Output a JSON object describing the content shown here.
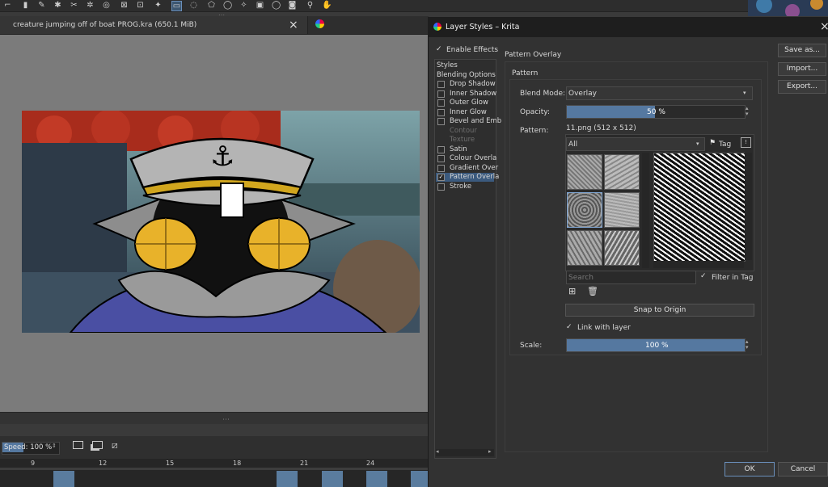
{
  "canvas": {
    "document_tab_title": "creature jumping off of boat PROG.kra (650.1 MiB)"
  },
  "timeline": {
    "speed_label": "Speed:",
    "speed_value": "100 %",
    "ticks": [
      "9",
      "12",
      "15",
      "18",
      "21",
      "24"
    ]
  },
  "dialog": {
    "title": "Layer Styles – Krita",
    "enable_effects": "Enable Effects",
    "styles_list": [
      {
        "label": "Styles",
        "checkbox": false,
        "checked": false,
        "disabled": false
      },
      {
        "label": "Blending Options",
        "checkbox": false,
        "checked": false,
        "disabled": false
      },
      {
        "label": "Drop Shadow",
        "checkbox": true,
        "checked": false,
        "disabled": false
      },
      {
        "label": "Inner Shadow",
        "checkbox": true,
        "checked": false,
        "disabled": false
      },
      {
        "label": "Outer Glow",
        "checkbox": true,
        "checked": false,
        "disabled": false
      },
      {
        "label": "Inner Glow",
        "checkbox": true,
        "checked": false,
        "disabled": false
      },
      {
        "label": "Bevel and Emb",
        "checkbox": true,
        "checked": false,
        "disabled": false
      },
      {
        "label": "Contour",
        "checkbox": false,
        "checked": false,
        "disabled": true
      },
      {
        "label": "Texture",
        "checkbox": false,
        "checked": false,
        "disabled": true
      },
      {
        "label": "Satin",
        "checkbox": true,
        "checked": false,
        "disabled": false
      },
      {
        "label": "Colour Overla",
        "checkbox": true,
        "checked": false,
        "disabled": false
      },
      {
        "label": "Gradient Over",
        "checkbox": true,
        "checked": false,
        "disabled": false
      },
      {
        "label": "Pattern Overla",
        "checkbox": true,
        "checked": true,
        "disabled": false
      },
      {
        "label": "Stroke",
        "checkbox": true,
        "checked": false,
        "disabled": false
      }
    ],
    "section_title": "Pattern Overlay",
    "group_title": "Pattern",
    "blend_mode_label": "Blend Mode:",
    "blend_mode_value": "Overlay",
    "opacity_label": "Opacity:",
    "opacity_value": "50 %",
    "opacity_fraction": 0.5,
    "pattern_label": "Pattern:",
    "pattern_name": "11.png (512 x 512)",
    "tag_filter_value": "All",
    "tag_button": "Tag",
    "search_placeholder": "Search",
    "filter_in_tag": "Filter in Tag",
    "snap_to_origin": "Snap to Origin",
    "link_with_layer": "Link with layer",
    "scale_label": "Scale:",
    "scale_value": "100 %",
    "save_as": "Save as...",
    "import": "Import...",
    "export": "Export...",
    "ok": "OK",
    "cancel": "Cancel"
  }
}
